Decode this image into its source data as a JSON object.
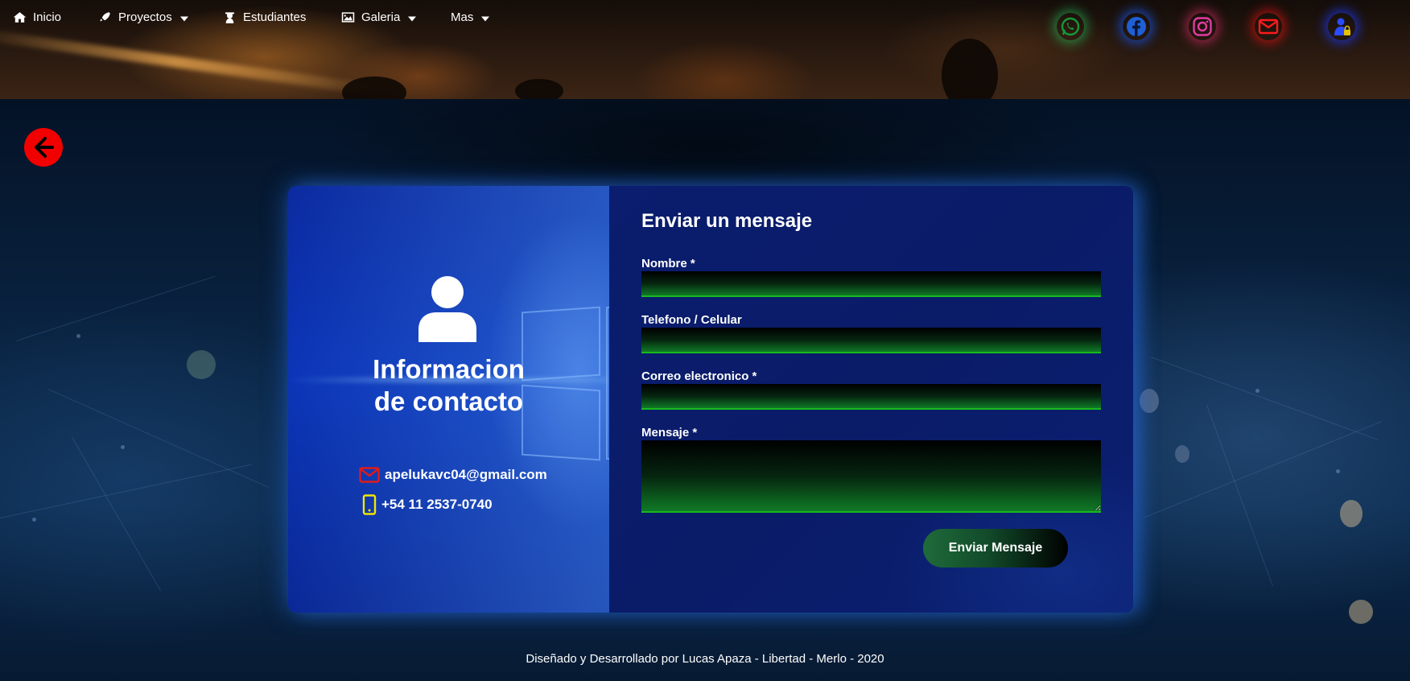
{
  "nav": {
    "items": [
      {
        "label": "Inicio",
        "icon": "home-icon",
        "has_dropdown": false
      },
      {
        "label": "Proyectos",
        "icon": "rocket-icon",
        "has_dropdown": true
      },
      {
        "label": "Estudiantes",
        "icon": "graduate-icon",
        "has_dropdown": false
      },
      {
        "label": "Galeria",
        "icon": "image-icon",
        "has_dropdown": true
      },
      {
        "label": "Mas",
        "icon": "",
        "has_dropdown": true
      }
    ]
  },
  "social": [
    {
      "name": "whatsapp-icon",
      "color": "#25d366"
    },
    {
      "name": "facebook-icon",
      "color": "#1877f2"
    },
    {
      "name": "instagram-icon",
      "color": "#e1306c"
    },
    {
      "name": "email-icon",
      "color": "#ff1a1a"
    },
    {
      "name": "admin-user-icon",
      "color": "#2a4bff"
    }
  ],
  "back": {
    "icon": "arrow-left-circle-icon",
    "color": "#f20000"
  },
  "contact": {
    "title_line1": "Informacion",
    "title_line2": "de contacto",
    "email": "apelukavc04@gmail.com",
    "phone": "+54 11 2537-0740",
    "email_icon_color": "#e01b1b",
    "phone_icon_color": "#f2e600"
  },
  "form": {
    "title": "Enviar un mensaje",
    "name_label": "Nombre *",
    "name_value": "",
    "phone_label": "Telefono / Celular",
    "phone_value": "",
    "email_label": "Correo electronico *",
    "email_value": "",
    "message_label": "Mensaje *",
    "message_value": "",
    "submit_label": "Enviar Mensaje",
    "accent_color": "#19b81e"
  },
  "footer": {
    "text": "Diseñado y Desarrollado por Lucas Apaza - Libertad - Merlo - 2020"
  }
}
